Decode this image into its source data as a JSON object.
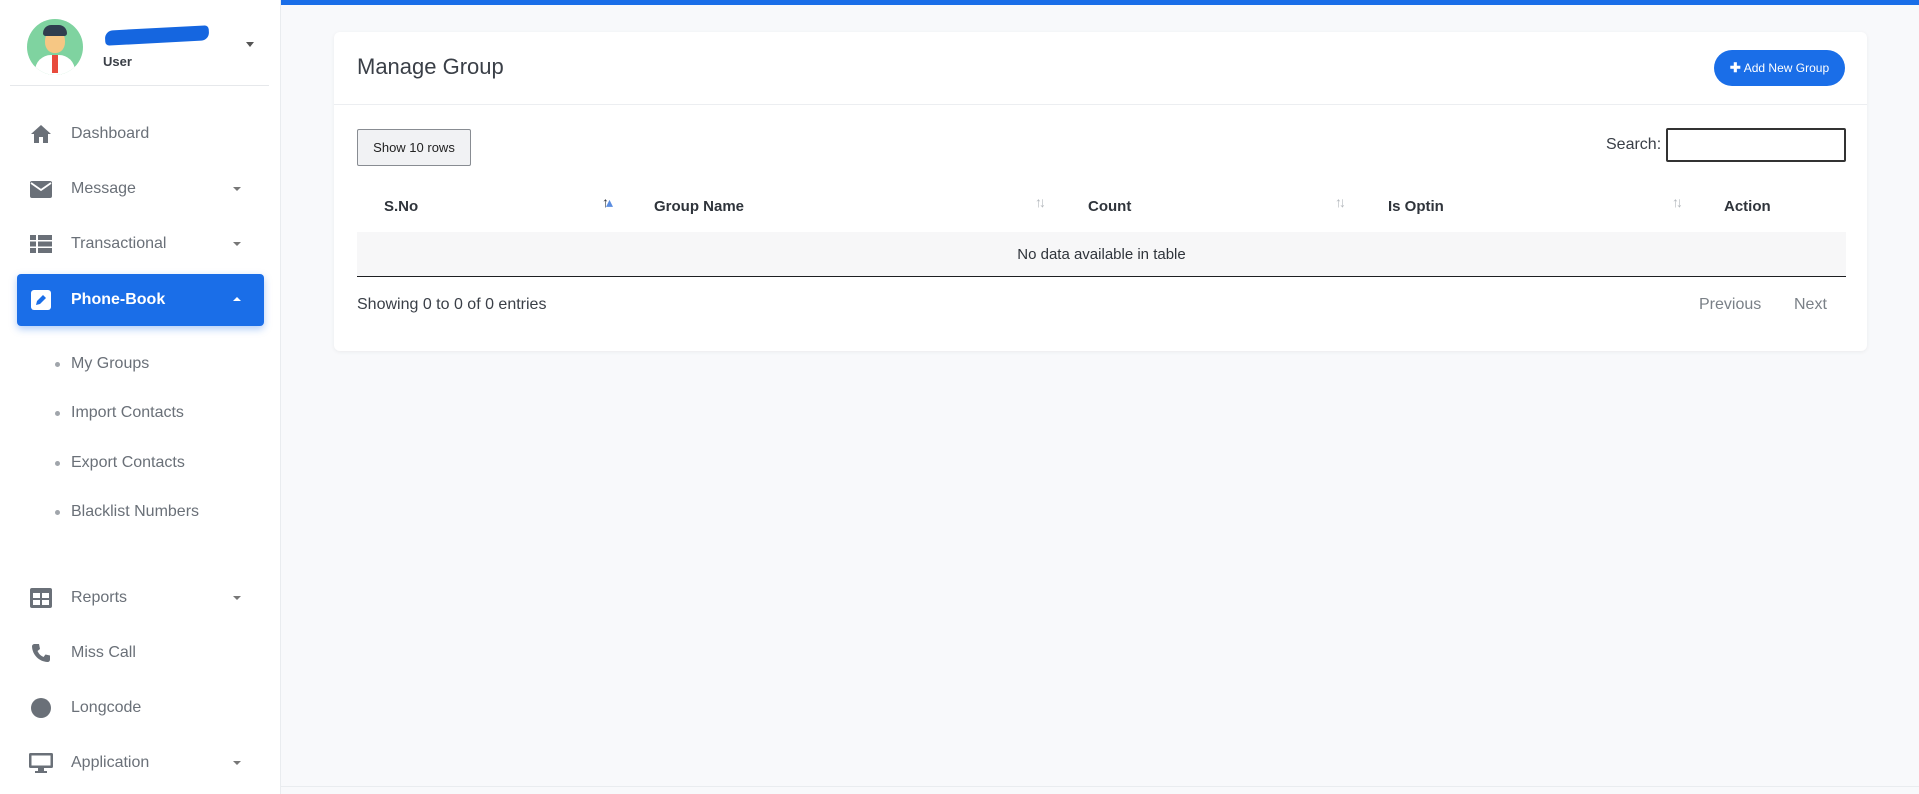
{
  "profile": {
    "role": "User"
  },
  "sidebar": {
    "items": [
      {
        "label": "Dashboard",
        "icon": "home-icon"
      },
      {
        "label": "Message",
        "icon": "envelope-icon"
      },
      {
        "label": "Transactional",
        "icon": "list-icon"
      },
      {
        "label": "Phone-Book",
        "icon": "edit-icon",
        "active": true
      },
      {
        "label": "Reports",
        "icon": "table-icon"
      },
      {
        "label": "Miss Call",
        "icon": "phone-icon"
      },
      {
        "label": "Longcode",
        "icon": "circle-icon"
      },
      {
        "label": "Application",
        "icon": "monitor-icon"
      }
    ],
    "phonebook_sub": [
      {
        "label": "My Groups"
      },
      {
        "label": "Import Contacts"
      },
      {
        "label": "Export Contacts"
      },
      {
        "label": "Blacklist Numbers"
      }
    ]
  },
  "main": {
    "title": "Manage Group",
    "add_button": "Add New Group",
    "rows_button": "Show 10 rows",
    "search_label": "Search:",
    "search_value": "",
    "columns": [
      "S.No",
      "Group Name",
      "Count",
      "Is Optin",
      "Action"
    ],
    "empty_message": "No data available in table",
    "info": "Showing 0 to 0 of 0 entries",
    "prev": "Previous",
    "next": "Next"
  },
  "colors": {
    "accent": "#1a6ee8",
    "background": "#f8f9fb"
  }
}
